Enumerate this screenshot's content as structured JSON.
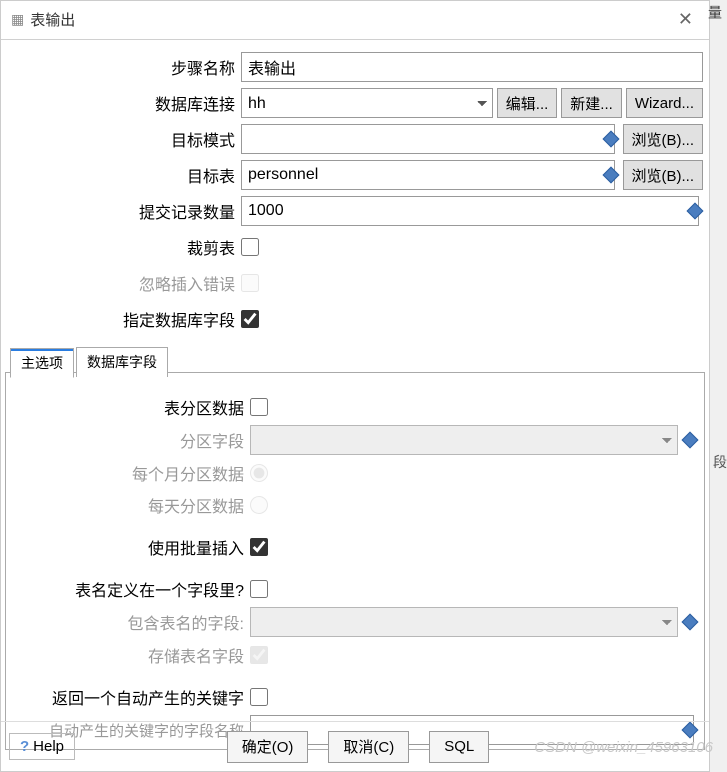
{
  "titlebar": {
    "title": "表输出"
  },
  "form": {
    "step_name": {
      "label": "步骤名称",
      "value": "表输出"
    },
    "db_conn": {
      "label": "数据库连接",
      "value": "hh",
      "btn_edit": "编辑...",
      "btn_new": "新建...",
      "btn_wizard": "Wizard..."
    },
    "target_schema": {
      "label": "目标模式",
      "value": "",
      "browse": "浏览(B)..."
    },
    "target_table": {
      "label": "目标表",
      "value": "personnel",
      "browse": "浏览(B)..."
    },
    "commit_size": {
      "label": "提交记录数量",
      "value": "1000"
    },
    "truncate": {
      "label": "裁剪表",
      "checked": false
    },
    "ignore_errors": {
      "label": "忽略插入错误",
      "checked": false
    },
    "specify_fields": {
      "label": "指定数据库字段",
      "checked": true
    }
  },
  "tabs": {
    "main": "主选项",
    "db_fields": "数据库字段"
  },
  "options": {
    "partition": {
      "label": "表分区数据",
      "checked": false
    },
    "partition_field": {
      "label": "分区字段",
      "value": ""
    },
    "partition_monthly": {
      "label": "每个月分区数据",
      "checked": true
    },
    "partition_daily": {
      "label": "每天分区数据",
      "checked": false
    },
    "batch_insert": {
      "label": "使用批量插入",
      "checked": true
    },
    "tablename_in_field": {
      "label": "表名定义在一个字段里?",
      "checked": false
    },
    "tablename_field": {
      "label": "包含表名的字段:",
      "value": ""
    },
    "store_tablename": {
      "label": "存储表名字段",
      "checked": true
    },
    "return_keys": {
      "label": "返回一个自动产生的关键字",
      "checked": false
    },
    "key_field_name": {
      "label": "自动产生的关键字的字段名称",
      "value": ""
    }
  },
  "buttons": {
    "help": "Help",
    "ok": "确定(O)",
    "cancel": "取消(C)",
    "sql": "SQL"
  },
  "watermark": "CSDN @weixin_45963106",
  "edge": {
    "top": "量",
    "mid": "段"
  }
}
